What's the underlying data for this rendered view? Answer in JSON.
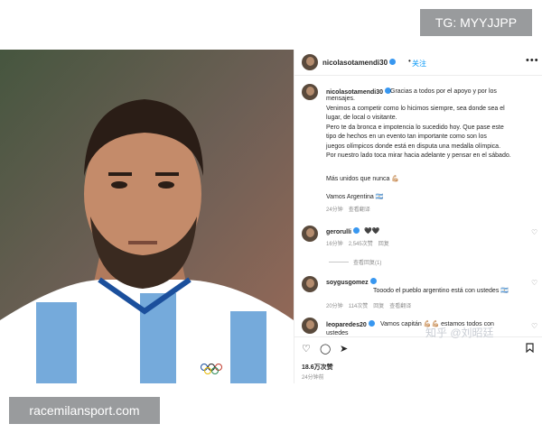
{
  "watermarks": {
    "top_right": "TG: MYYJJPP",
    "bottom_left": "racemilansport.com",
    "zhihu": "知乎 @刘昭廷"
  },
  "post": {
    "username": "nicolasotamendi30",
    "follow_label": "关注",
    "caption_lines": [
      "Gracias a todos por el apoyo y por los",
      "mensajes.",
      "Venimos a competir como lo hicimos siempre, sea donde sea el",
      "lugar, de local o visitante.",
      "Pero te da bronca e impotencia lo sucedido hoy. Que pase este",
      "tipo de hechos en un evento tan importante como son los",
      "juegos olímpicos donde está en disputa una medalla olímpica.",
      "Por nuestro lado toca mirar hacia adelante y pensar en el sábado."
    ],
    "caption_extra_1": "Más unidos que nunca 💪🏼",
    "caption_extra_2": "Vamos Argentina 🇦🇷",
    "caption_meta": {
      "time": "24分钟",
      "translate": "查看翻译"
    },
    "likes": "18.6万次赞",
    "posted": "24分钟前",
    "icons": {
      "header_more": "ellipsis-icon",
      "like": "heart-icon",
      "comment": "comment-icon",
      "share": "share-icon",
      "save": "bookmark-icon"
    }
  },
  "comments": [
    {
      "user": "gerorulli",
      "text": "🖤🖤",
      "time": "16分钟",
      "likes": "2,545次赞",
      "reply": "回复"
    },
    {
      "user": "soygusgomez",
      "text": "Tooodo el pueblo argentino está con ustedes 🇦🇷",
      "time": "20分钟",
      "likes": "114次赞",
      "reply": "回复",
      "translate": "查看翻译"
    },
    {
      "user": "leoparedes20",
      "text": "Vamos capitán 💪🏼💪🏼 estamos todos con",
      "cut": "ustedes"
    }
  ],
  "replies_label": "查看回复(1)",
  "colors": {
    "verified": "#3897f0",
    "follow": "#0095f6",
    "shirt_blue": "#75aadb"
  }
}
